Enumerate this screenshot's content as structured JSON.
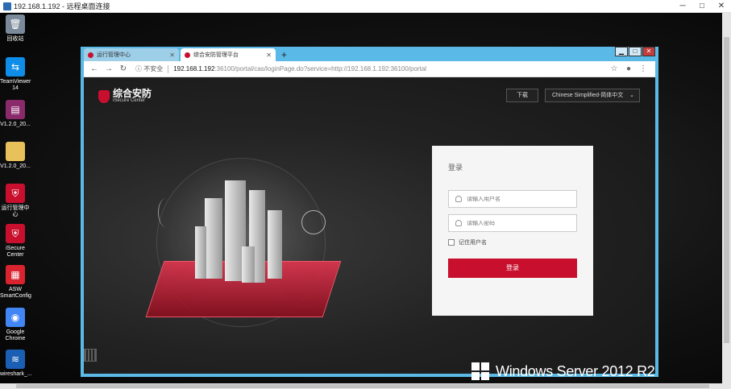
{
  "rdp": {
    "title": "192.168.1.192 - 远程桌面连接",
    "controls": [
      "─",
      "□",
      "✕"
    ]
  },
  "desktop_icons": [
    {
      "label": "回收站",
      "icon": "recycle-bin-icon",
      "color": "#7a8a9a"
    },
    {
      "label": "TeamViewer 14",
      "icon": "teamviewer-icon",
      "color": "#0e8ee9"
    },
    {
      "label": "V1.2.0_20...",
      "icon": "winrar-archive-icon",
      "color": "#8b2a6b"
    },
    {
      "label": "V1.2.0_20...",
      "icon": "folder-icon",
      "color": "#e8c15a"
    },
    {
      "label": "运行管理中心",
      "icon": "ops-center-icon",
      "color": "#c8102e"
    },
    {
      "label": "iSecure Center",
      "icon": "isecure-icon",
      "color": "#c8102e"
    },
    {
      "label": "ASW SmartConfig",
      "icon": "asw-icon",
      "color": "#d9232e"
    },
    {
      "label": "Google Chrome",
      "icon": "chrome-icon",
      "color": "#4285f4"
    },
    {
      "label": "wireshark_...",
      "icon": "wireshark-icon",
      "color": "#1a5fb4"
    }
  ],
  "browser": {
    "tabs": [
      {
        "label": "运行管理中心",
        "active": false
      },
      {
        "label": "综合安防管理平台",
        "active": true
      }
    ],
    "address": {
      "security": "不安全",
      "host": "192.168.1.192",
      "rest": ":36100/portal/cas/loginPage.do?service=http://192.168.1.192:36100/portal"
    }
  },
  "page": {
    "brand": {
      "name": "综合安防",
      "sub": "iSecure Center"
    },
    "download": "下载",
    "language": "Chinese Simplified-简体中文",
    "login": {
      "title": "登录",
      "username_placeholder": "请输入用户名",
      "password_placeholder": "请输入密码",
      "remember": "记住用户名",
      "submit": "登录"
    },
    "accent": "#c8102e"
  },
  "os_watermark": "Windows Server 2012 R2"
}
